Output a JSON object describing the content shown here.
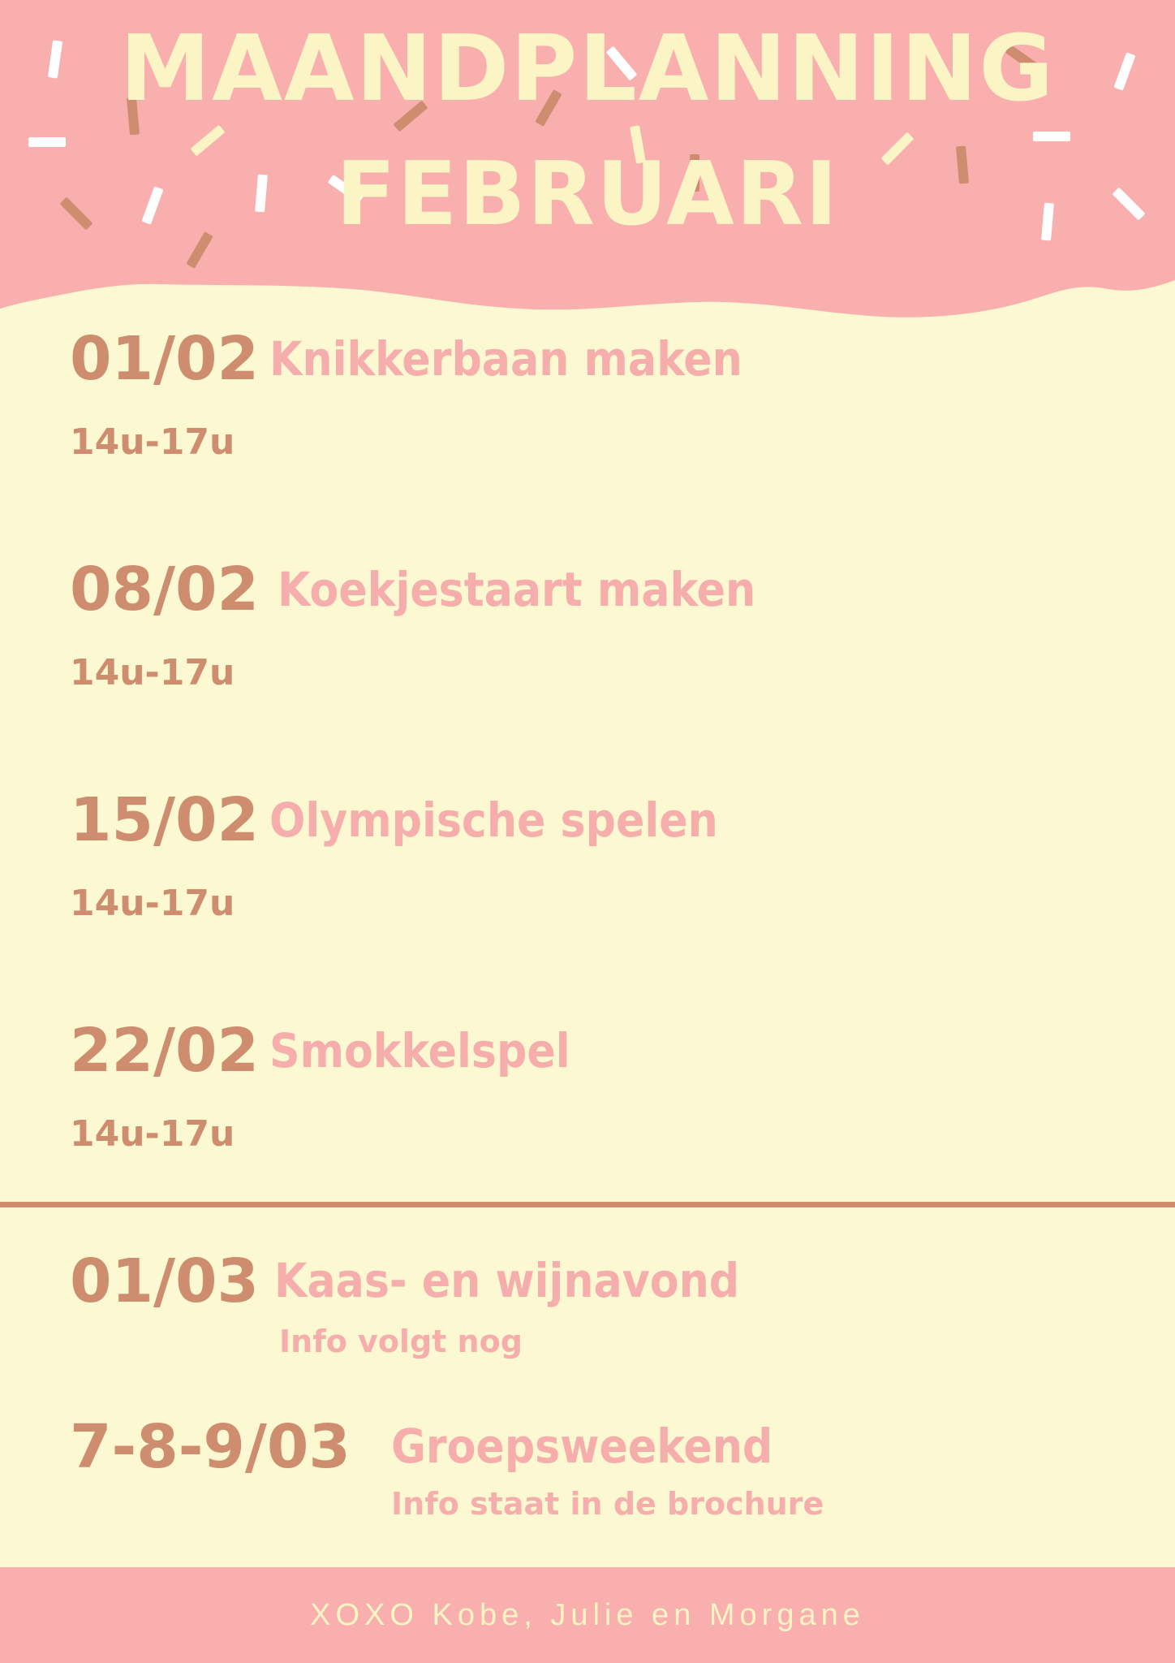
{
  "header": {
    "title_line1": "MAANDPLANNING",
    "title_line2": "FEBRUARI"
  },
  "events": [
    {
      "date": "01/02",
      "name": "Knikkerbaan maken",
      "time": "14u-17u"
    },
    {
      "date": "08/02",
      "name": "Koekjestaart maken",
      "time": "14u-17u"
    },
    {
      "date": "15/02",
      "name": "Olympische spelen",
      "time": "14u-17u"
    },
    {
      "date": "22/02",
      "name": "Smokkelspel",
      "time": "14u-17u"
    }
  ],
  "upcoming": [
    {
      "date": "01/03",
      "name": "Kaas- en wijnavond",
      "info": "Info volgt nog"
    },
    {
      "date": "7-8-9/03",
      "name": "Groepsweekend",
      "info": "Info staat in de brochure"
    }
  ],
  "footer": {
    "text": "XOXO Kobe, Julie en Morgane"
  },
  "colors": {
    "background": "#fcf8d2",
    "header_pink": "#f8afae",
    "cream": "#fbf4c4",
    "brown": "#cd8d6e",
    "pink_text": "#f5aeac"
  }
}
